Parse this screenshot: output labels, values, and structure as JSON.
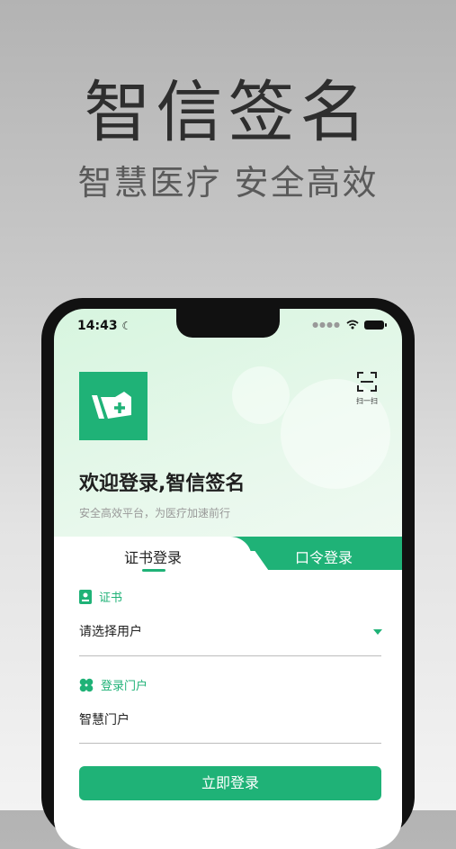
{
  "hero": {
    "title": "智信签名",
    "subtitle": "智慧医疗 安全高效"
  },
  "status_bar": {
    "time": "14:43"
  },
  "scan": {
    "label": "扫一扫"
  },
  "welcome": {
    "title": "欢迎登录,智信签名",
    "tagline": "安全高效平台，为医疗加速前行"
  },
  "tabs": [
    {
      "label": "证书登录",
      "active": true
    },
    {
      "label": "口令登录",
      "active": false
    }
  ],
  "form": {
    "cert_label": "证书",
    "cert_value": "请选择用户",
    "portal_label": "登录门户",
    "portal_value": "智慧门户",
    "login_button": "立即登录"
  },
  "colors": {
    "accent": "#1fb277"
  }
}
